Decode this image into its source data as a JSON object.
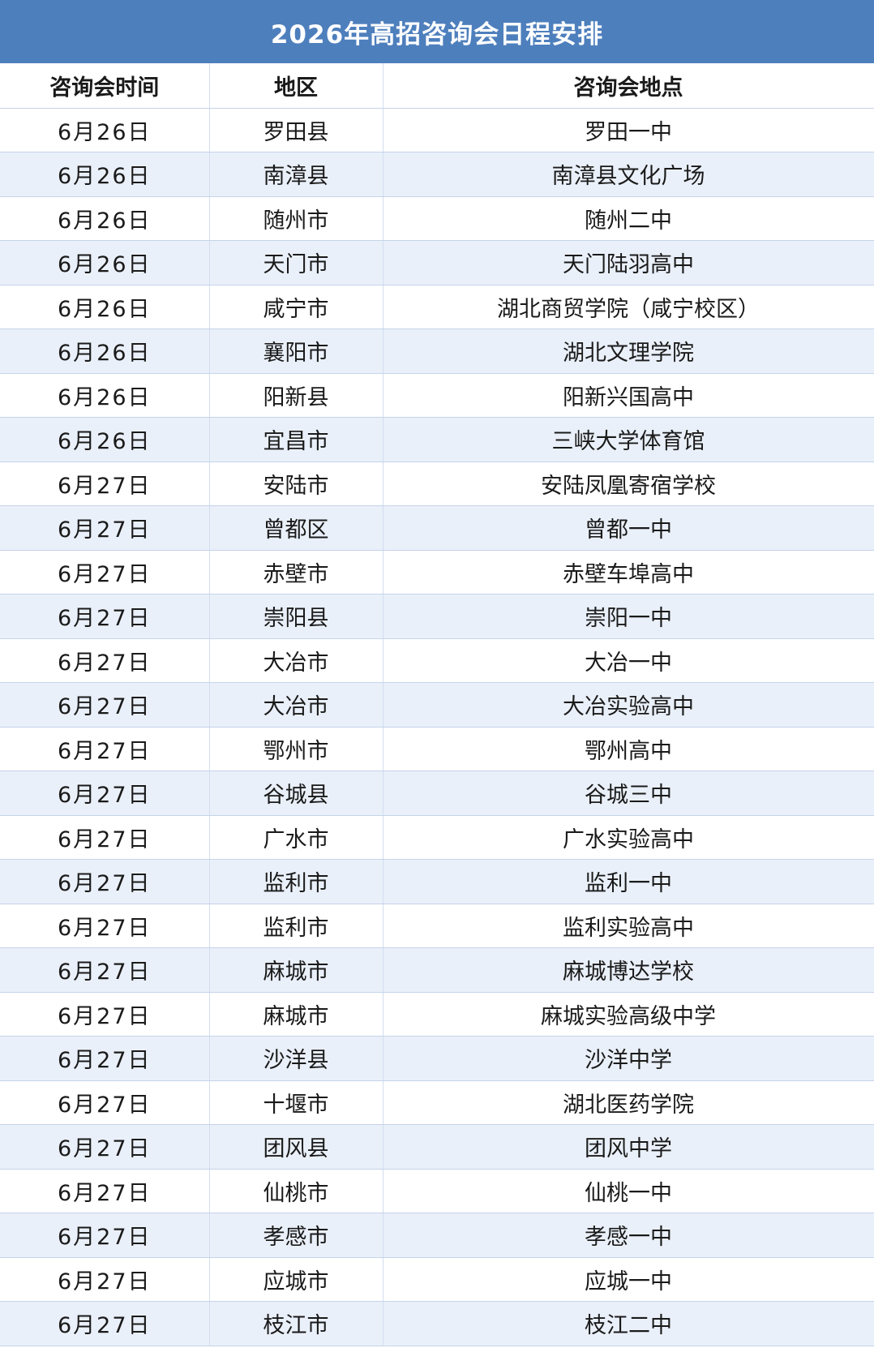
{
  "title": "2026年高招咨询会日程安排",
  "headers": [
    "咨询会时间",
    "地区",
    "咨询会地点"
  ],
  "rows": [
    [
      "6月26日",
      "罗田县",
      "罗田一中"
    ],
    [
      "6月26日",
      "南漳县",
      "南漳县文化广场"
    ],
    [
      "6月26日",
      "随州市",
      "随州二中"
    ],
    [
      "6月26日",
      "天门市",
      "天门陆羽高中"
    ],
    [
      "6月26日",
      "咸宁市",
      "湖北商贸学院（咸宁校区）"
    ],
    [
      "6月26日",
      "襄阳市",
      "湖北文理学院"
    ],
    [
      "6月26日",
      "阳新县",
      "阳新兴国高中"
    ],
    [
      "6月26日",
      "宜昌市",
      "三峡大学体育馆"
    ],
    [
      "6月27日",
      "安陆市",
      "安陆凤凰寄宿学校"
    ],
    [
      "6月27日",
      "曾都区",
      "曾都一中"
    ],
    [
      "6月27日",
      "赤壁市",
      "赤壁车埠高中"
    ],
    [
      "6月27日",
      "崇阳县",
      "崇阳一中"
    ],
    [
      "6月27日",
      "大冶市",
      "大冶一中"
    ],
    [
      "6月27日",
      "大冶市",
      "大冶实验高中"
    ],
    [
      "6月27日",
      "鄂州市",
      "鄂州高中"
    ],
    [
      "6月27日",
      "谷城县",
      "谷城三中"
    ],
    [
      "6月27日",
      "广水市",
      "广水实验高中"
    ],
    [
      "6月27日",
      "监利市",
      "监利一中"
    ],
    [
      "6月27日",
      "监利市",
      "监利实验高中"
    ],
    [
      "6月27日",
      "麻城市",
      "麻城博达学校"
    ],
    [
      "6月27日",
      "麻城市",
      "麻城实验高级中学"
    ],
    [
      "6月27日",
      "沙洋县",
      "沙洋中学"
    ],
    [
      "6月27日",
      "十堰市",
      "湖北医药学院"
    ],
    [
      "6月27日",
      "团风县",
      "团风中学"
    ],
    [
      "6月27日",
      "仙桃市",
      "仙桃一中"
    ],
    [
      "6月27日",
      "孝感市",
      "孝感一中"
    ],
    [
      "6月27日",
      "应城市",
      "应城一中"
    ],
    [
      "6月27日",
      "枝江市",
      "枝江二中"
    ]
  ],
  "colors": {
    "title_bar": "#4e7fbd",
    "stripe": "#eaf0f9",
    "grid": "#c5d3ea"
  }
}
